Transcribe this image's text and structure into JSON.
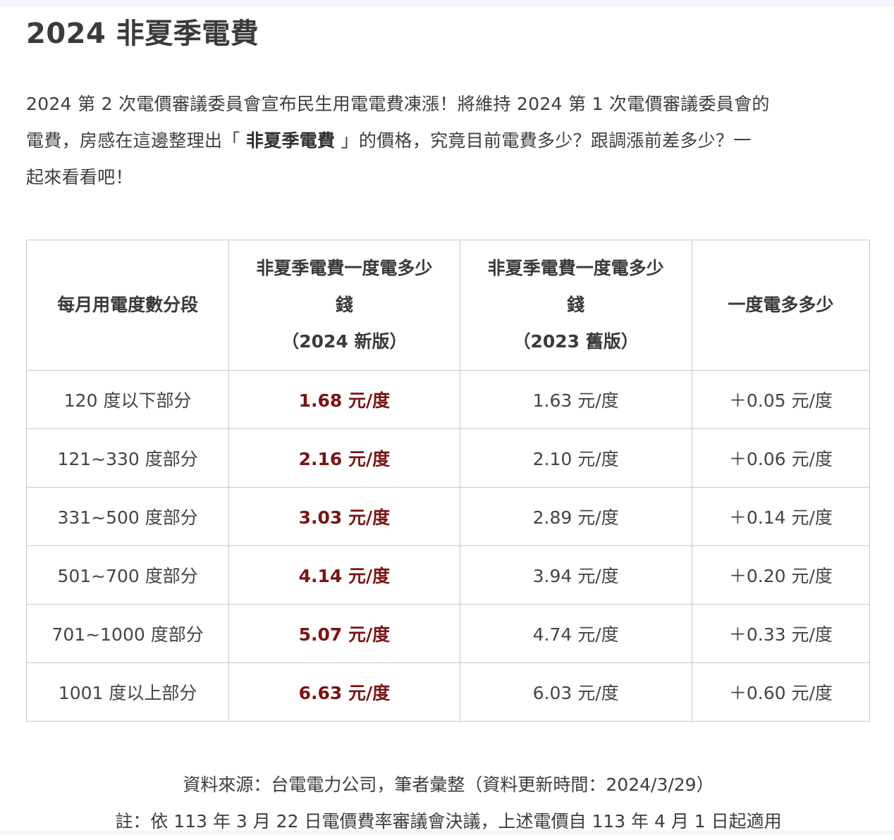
{
  "title": "2024 非夏季電費",
  "intro": {
    "line1": "2024 第 2 次電價審議委員會宣布民生用電電費凍漲！將維持 2024 第 1 次電價審議委員會的",
    "line2_before": "電費，房感在這邊整理出「 ",
    "line2_bold": "非夏季電費",
    "line2_after": " 」的價格，究竟目前電費多少？跟調漲前差多少？一",
    "line3": "起來看看吧！"
  },
  "table": {
    "headers": {
      "col1": "每月用電度數分段",
      "col2_line1": "非夏季電費一度電多少",
      "col2_line2": "錢",
      "col2_line3": "（2024 新版）",
      "col3_line1": "非夏季電費一度電多少",
      "col3_line2": "錢",
      "col3_line3": "（2023 舊版）",
      "col4": "一度電多多少"
    },
    "rows": [
      {
        "range": "120 度以下部分",
        "new": "1.68 元/度",
        "old": "1.63 元/度",
        "diff": "＋0.05 元/度"
      },
      {
        "range": "121~330 度部分",
        "new": "2.16 元/度",
        "old": "2.10 元/度",
        "diff": "＋0.06 元/度"
      },
      {
        "range": "331~500 度部分",
        "new": "3.03 元/度",
        "old": "2.89 元/度",
        "diff": "＋0.14 元/度"
      },
      {
        "range": "501~700 度部分",
        "new": "4.14 元/度",
        "old": "3.94 元/度",
        "diff": "＋0.20 元/度"
      },
      {
        "range": "701~1000 度部分",
        "new": "5.07 元/度",
        "old": "4.74 元/度",
        "diff": "＋0.33 元/度"
      },
      {
        "range": "1001 度以上部分",
        "new": "6.63 元/度",
        "old": "6.03 元/度",
        "diff": "＋0.60 元/度"
      }
    ]
  },
  "source": {
    "line1": "資料來源：台電電力公司，筆者彙整（資料更新時間：2024/3/29）",
    "line2": "註：依 113 年 3 月 22 日電價費率審議會決議，上述電價自 113 年 4 月 1 日起適用"
  },
  "colors": {
    "new_price": "#7a1414",
    "text": "#3a3a3a",
    "border": "#c9c9c9"
  }
}
